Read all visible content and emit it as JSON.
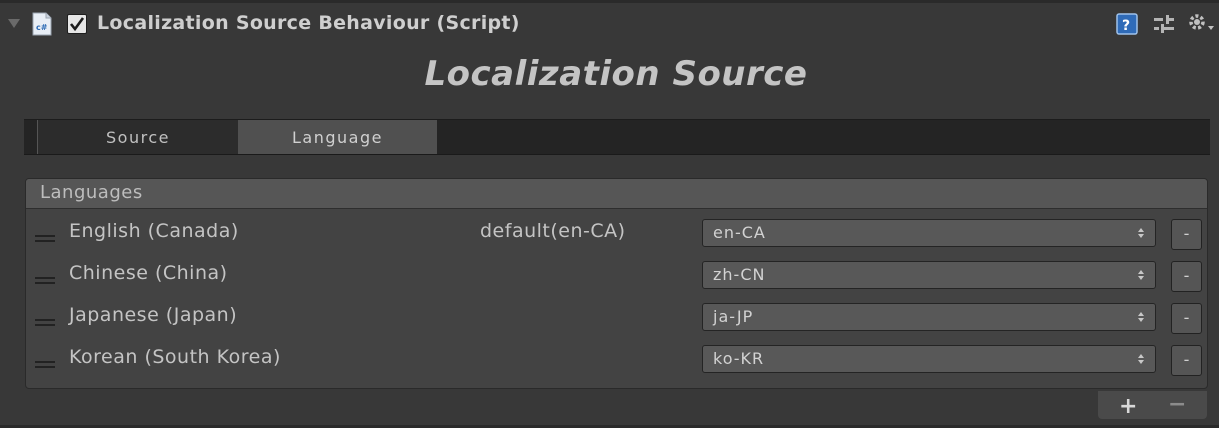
{
  "header": {
    "title": "Localization Source Behaviour (Script)",
    "enabled": true,
    "icons": [
      "cs-script-icon",
      "help-icon",
      "preset-icon",
      "gear-icon"
    ]
  },
  "main_title": "Localization Source",
  "tabs": [
    {
      "label": "Source",
      "active": false
    },
    {
      "label": "Language",
      "active": true
    }
  ],
  "list": {
    "header": "Languages",
    "rows": [
      {
        "name": "English (Canada)",
        "default_label": "default(en-CA)",
        "code": "en-CA",
        "remove": "-"
      },
      {
        "name": "Chinese (China)",
        "default_label": "",
        "code": "zh-CN",
        "remove": "-"
      },
      {
        "name": "Japanese (Japan)",
        "default_label": "",
        "code": "ja-JP",
        "remove": "-"
      },
      {
        "name": "Korean (South Korea)",
        "default_label": "",
        "code": "ko-KR",
        "remove": "-"
      }
    ],
    "add_label": "+",
    "remove_label": "−"
  },
  "colors": {
    "background": "#383838",
    "active_tab": "#505050",
    "list_header": "#565656"
  }
}
